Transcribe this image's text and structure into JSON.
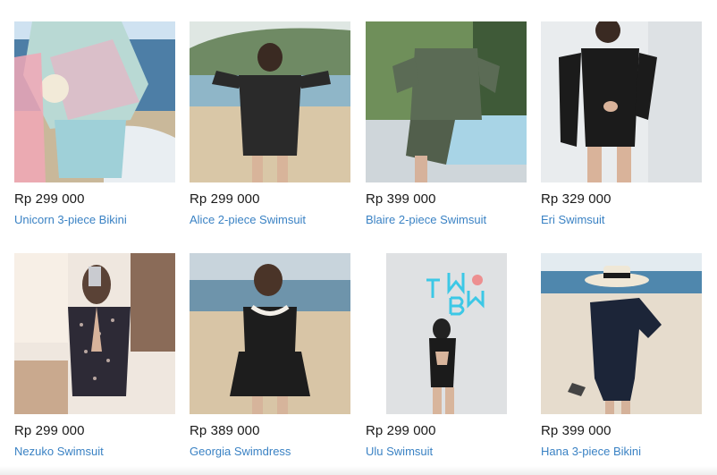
{
  "products": [
    {
      "price": "Rp 299 000",
      "name": "Unicorn 3-piece Bikini"
    },
    {
      "price": "Rp 299 000",
      "name": "Alice 2-piece Swimsuit"
    },
    {
      "price": "Rp 399 000",
      "name": "Blaire 2-piece Swimsuit"
    },
    {
      "price": "Rp 329 000",
      "name": "Eri Swimsuit"
    },
    {
      "price": "Rp 299 000",
      "name": "Nezuko Swimsuit"
    },
    {
      "price": "Rp 389 000",
      "name": "Georgia Swimdress"
    },
    {
      "price": "Rp 299 000",
      "name": "Ulu Swimsuit"
    },
    {
      "price": "Rp 399 000",
      "name": "Hana 3-piece Bikini"
    }
  ],
  "colors": {
    "link": "#3a82c4",
    "price": "#1a1a1a"
  }
}
